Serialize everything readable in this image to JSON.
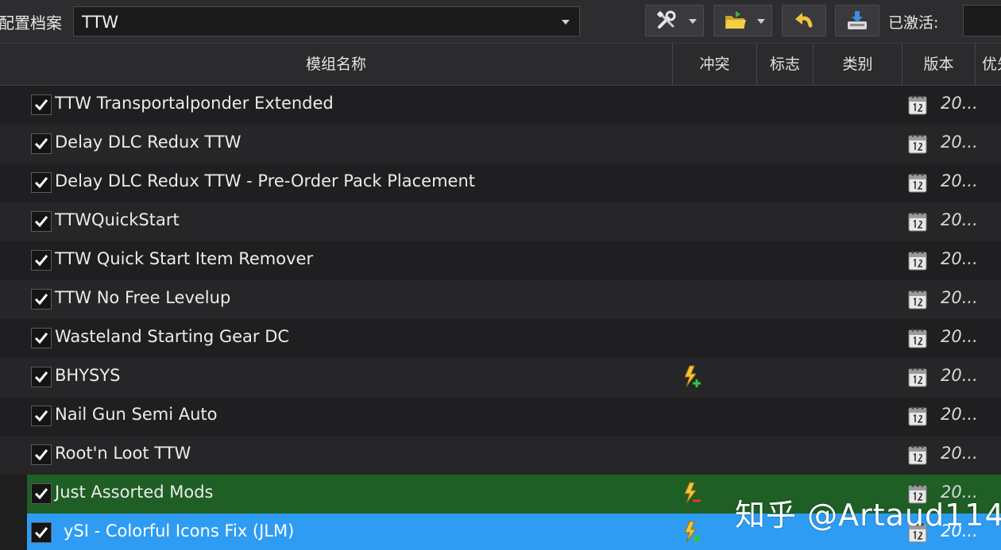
{
  "toolbar": {
    "profile_label": "配置档案",
    "profile_value": "TTW",
    "activated_label": "已激活:"
  },
  "icons": {
    "tools": "tools-icon",
    "folder": "folder-icon",
    "undo": "undo-icon",
    "install": "install-icon",
    "calendar": "calendar-icon",
    "conflict": "conflict-icon"
  },
  "columns": [
    {
      "label": "模组名称"
    },
    {
      "label": "冲突"
    },
    {
      "label": "标志"
    },
    {
      "label": "类别"
    },
    {
      "label": "版本"
    },
    {
      "label": "优先"
    }
  ],
  "rows": [
    {
      "name": "TTW Transportalponder Extended",
      "version": "20...",
      "checked": true,
      "conflict": "",
      "style": "odd"
    },
    {
      "name": "Delay DLC Redux TTW",
      "version": "20...",
      "checked": true,
      "conflict": "",
      "style": "even"
    },
    {
      "name": "Delay DLC Redux TTW - Pre-Order Pack Placement",
      "version": "20...",
      "checked": true,
      "conflict": "",
      "style": "odd"
    },
    {
      "name": "TTWQuickStart",
      "version": "20...",
      "checked": true,
      "conflict": "",
      "style": "even"
    },
    {
      "name": "TTW Quick Start Item Remover",
      "version": "20...",
      "checked": true,
      "conflict": "",
      "style": "odd"
    },
    {
      "name": "TTW No Free Levelup",
      "version": "20...",
      "checked": true,
      "conflict": "",
      "style": "even"
    },
    {
      "name": "Wasteland Starting Gear DC",
      "version": "20...",
      "checked": true,
      "conflict": "",
      "style": "odd"
    },
    {
      "name": "BHYSYS",
      "version": "20...",
      "checked": true,
      "conflict": "plus",
      "style": "even"
    },
    {
      "name": "Nail Gun Semi Auto",
      "version": "20...",
      "checked": true,
      "conflict": "",
      "style": "odd"
    },
    {
      "name": "Root'n Loot TTW",
      "version": "20...",
      "checked": true,
      "conflict": "",
      "style": "even"
    },
    {
      "name": "Just Assorted Mods",
      "version": "20...",
      "checked": true,
      "conflict": "minus",
      "style": "green"
    },
    {
      "name": "ySI - Colorful Icons Fix (JLM)",
      "version": "20...",
      "checked": true,
      "conflict": "plus",
      "style": "blue"
    }
  ],
  "watermark": "知乎 @Artaud114",
  "colors": {
    "bg": "#1e1e1e",
    "highlight_green": "#1f5e24",
    "selected_blue": "#2e9cf3"
  }
}
